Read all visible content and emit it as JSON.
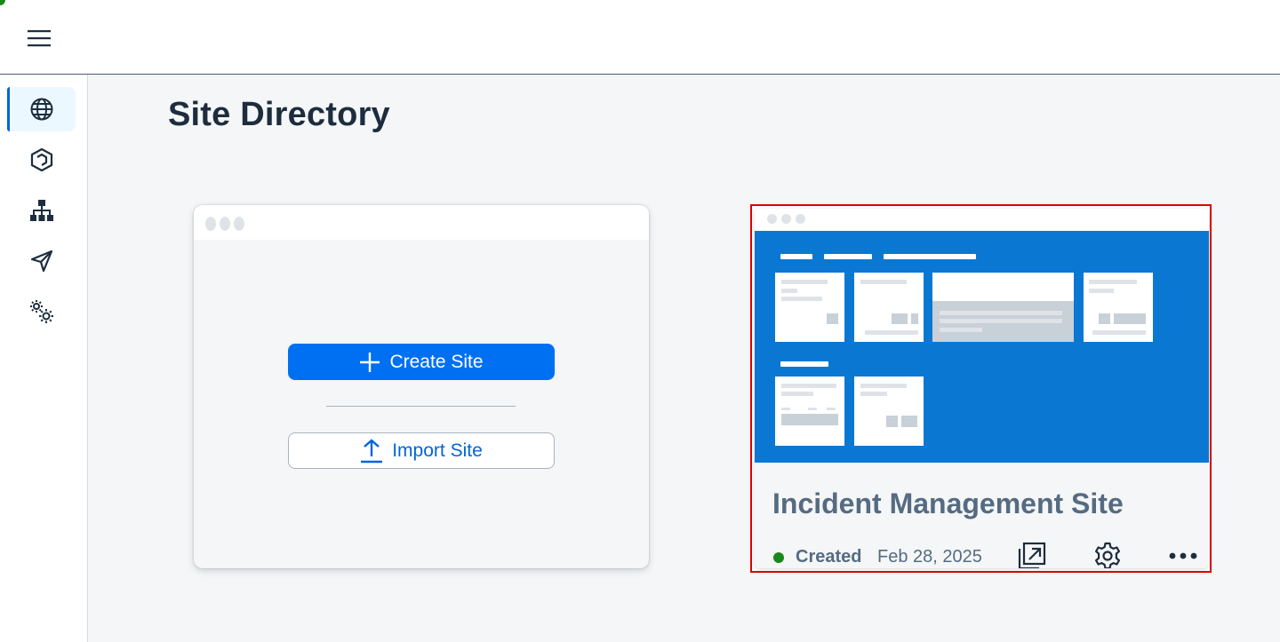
{
  "page": {
    "title": "Site Directory"
  },
  "shell": {
    "menu_icon": "hamburger-menu-icon"
  },
  "side_nav": {
    "items": [
      {
        "name": "sites",
        "icon": "globe-icon",
        "selected": true
      },
      {
        "name": "content-manager",
        "icon": "cube-icon",
        "selected": false
      },
      {
        "name": "channel-manager",
        "icon": "org-chart-icon",
        "selected": false
      },
      {
        "name": "provider-manager",
        "icon": "paper-plane-icon",
        "selected": false
      },
      {
        "name": "settings",
        "icon": "settings-gears-icon",
        "selected": false
      }
    ]
  },
  "create_card": {
    "create_label": "Create Site",
    "import_label": "Import Site"
  },
  "site_card": {
    "name": "Incident Management Site",
    "status": "Created",
    "status_color": "#188918",
    "date": "Feb 28, 2025",
    "actions": [
      "open-in-new-window-icon",
      "settings-icon",
      "more-icon"
    ],
    "preview_color": "#0a78d2"
  },
  "colors": {
    "accent": "#0070f2",
    "title": "#1d2d3e",
    "highlight_border": "#e00000"
  }
}
